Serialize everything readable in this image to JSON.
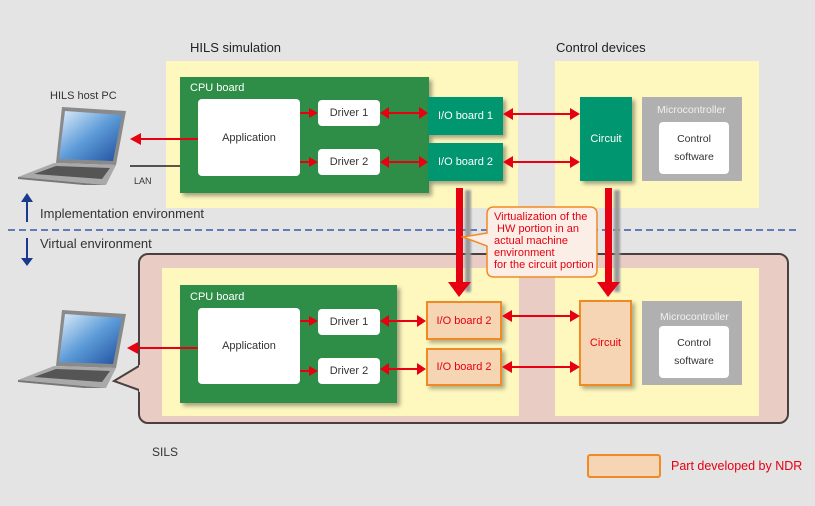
{
  "hils": {
    "section_title": "HILS simulation",
    "host_pc_label": "HILS host PC",
    "lan_label": "LAN",
    "cpu_board_label": "CPU board",
    "application_label": "Application",
    "drivers": [
      "Driver 1",
      "Driver 2"
    ],
    "io_boards": [
      "I/O board 1",
      "I/O board 2"
    ]
  },
  "control_devices": {
    "section_title": "Control devices",
    "circuit_label": "Circuit",
    "microcontroller_label": "Microcontroller",
    "control_software_label": "Control\nsoftware"
  },
  "environments": {
    "implementation_label": "Implementation environment",
    "virtual_label": "Virtual environment"
  },
  "callout": {
    "text": "Virtualization of the\n HW portion in an\nactual machine\nenvironment\nfor the circuit portion"
  },
  "sils": {
    "section_title": "SILS",
    "cpu_board_label": "CPU board",
    "application_label": "Application",
    "drivers": [
      "Driver 1",
      "Driver 2"
    ],
    "io_boards": [
      "I/O board 2",
      "I/O board 2"
    ],
    "circuit_label": "Circuit",
    "microcontroller_label": "Microcontroller",
    "control_software_label": "Control\nsoftware"
  },
  "legend": {
    "label": "Part developed by NDR"
  },
  "colors": {
    "background": "#e4e4e4",
    "zone_yellow": "#fef8bf",
    "cpu_green": "#2e8e47",
    "io_teal": "#009670",
    "arrow_red": "#e60012",
    "ndr_fill": "#f6d5b4",
    "ndr_border": "#f08a24",
    "sils_fill": "#e9cdc4",
    "env_arrow_blue": "#1a3a8f"
  }
}
